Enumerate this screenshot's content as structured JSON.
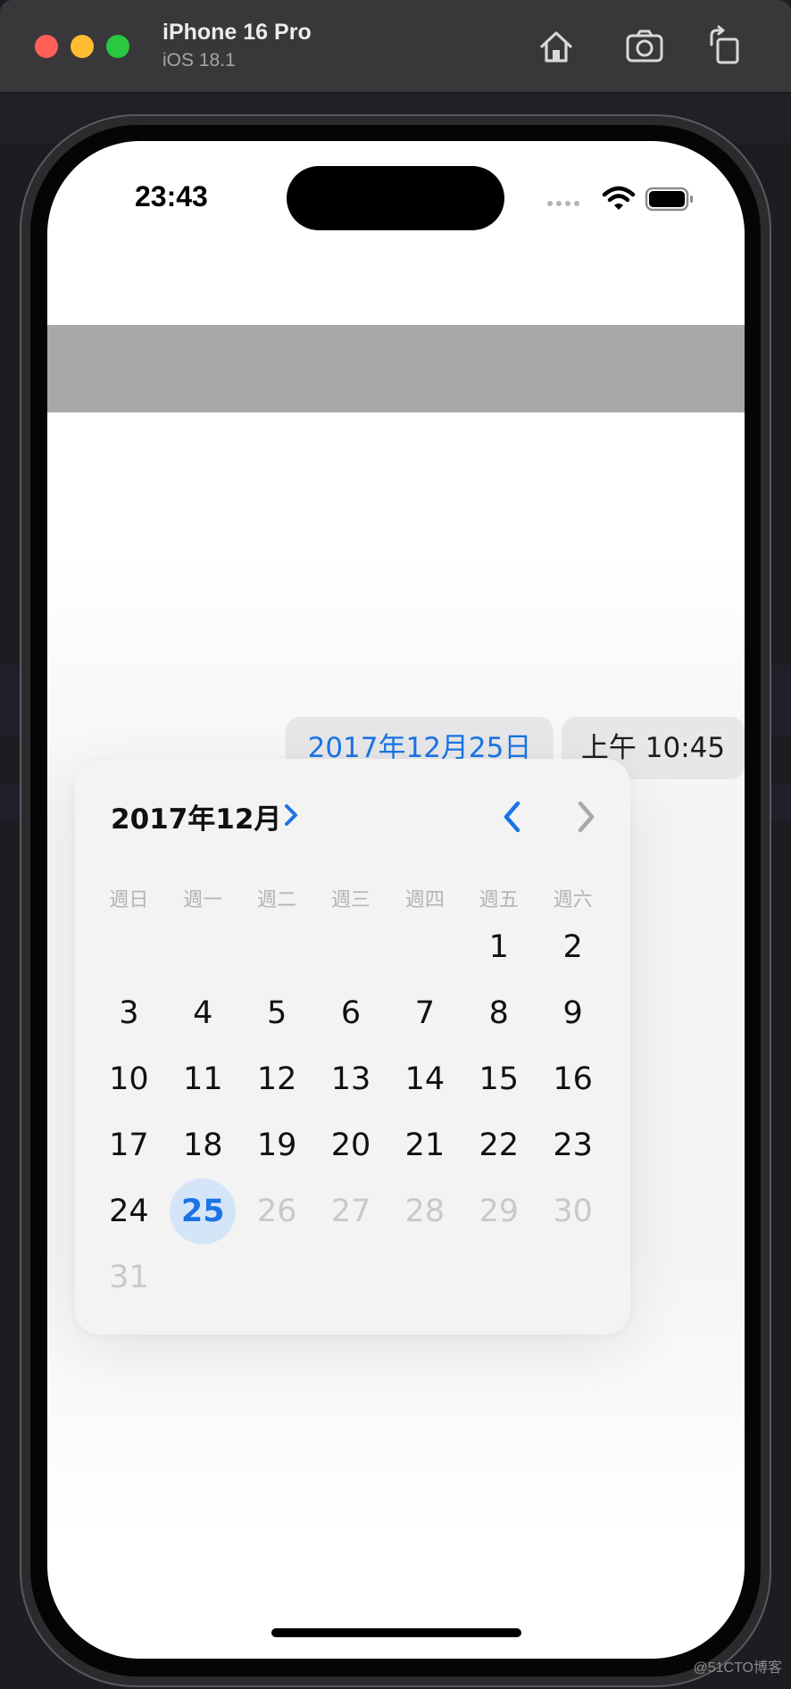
{
  "window": {
    "device_name": "iPhone 16 Pro",
    "os_version": "iOS 18.1",
    "toolbar_icons": [
      "home-icon",
      "screenshot-icon",
      "rotate-icon"
    ]
  },
  "status_bar": {
    "time": "23:43",
    "icons": [
      "signal-icon",
      "wifi-icon",
      "battery-icon"
    ]
  },
  "date_picker": {
    "date_label": "2017年12月25日",
    "time_label": "上午 10:45"
  },
  "calendar": {
    "month_title": "2017年12月",
    "weekdays": [
      "週日",
      "週一",
      "週二",
      "週三",
      "週四",
      "週五",
      "週六"
    ],
    "days": [
      {
        "label": "",
        "state": "empty"
      },
      {
        "label": "",
        "state": "empty"
      },
      {
        "label": "",
        "state": "empty"
      },
      {
        "label": "",
        "state": "empty"
      },
      {
        "label": "",
        "state": "empty"
      },
      {
        "label": "1",
        "state": "normal"
      },
      {
        "label": "2",
        "state": "normal"
      },
      {
        "label": "3",
        "state": "normal"
      },
      {
        "label": "4",
        "state": "normal"
      },
      {
        "label": "5",
        "state": "normal"
      },
      {
        "label": "6",
        "state": "normal"
      },
      {
        "label": "7",
        "state": "normal"
      },
      {
        "label": "8",
        "state": "normal"
      },
      {
        "label": "9",
        "state": "normal"
      },
      {
        "label": "10",
        "state": "normal"
      },
      {
        "label": "11",
        "state": "normal"
      },
      {
        "label": "12",
        "state": "normal"
      },
      {
        "label": "13",
        "state": "normal"
      },
      {
        "label": "14",
        "state": "normal"
      },
      {
        "label": "15",
        "state": "normal"
      },
      {
        "label": "16",
        "state": "normal"
      },
      {
        "label": "17",
        "state": "normal"
      },
      {
        "label": "18",
        "state": "normal"
      },
      {
        "label": "19",
        "state": "normal"
      },
      {
        "label": "20",
        "state": "normal"
      },
      {
        "label": "21",
        "state": "normal"
      },
      {
        "label": "22",
        "state": "normal"
      },
      {
        "label": "23",
        "state": "normal"
      },
      {
        "label": "24",
        "state": "normal"
      },
      {
        "label": "25",
        "state": "selected"
      },
      {
        "label": "26",
        "state": "disabled"
      },
      {
        "label": "27",
        "state": "disabled"
      },
      {
        "label": "28",
        "state": "disabled"
      },
      {
        "label": "29",
        "state": "disabled"
      },
      {
        "label": "30",
        "state": "disabled"
      },
      {
        "label": "31",
        "state": "disabled"
      }
    ]
  },
  "colors": {
    "accent": "#1a74e6",
    "selected_bg": "#d5e5f8",
    "disabled": "#c9c9cc"
  },
  "watermark": "@51CTO博客"
}
